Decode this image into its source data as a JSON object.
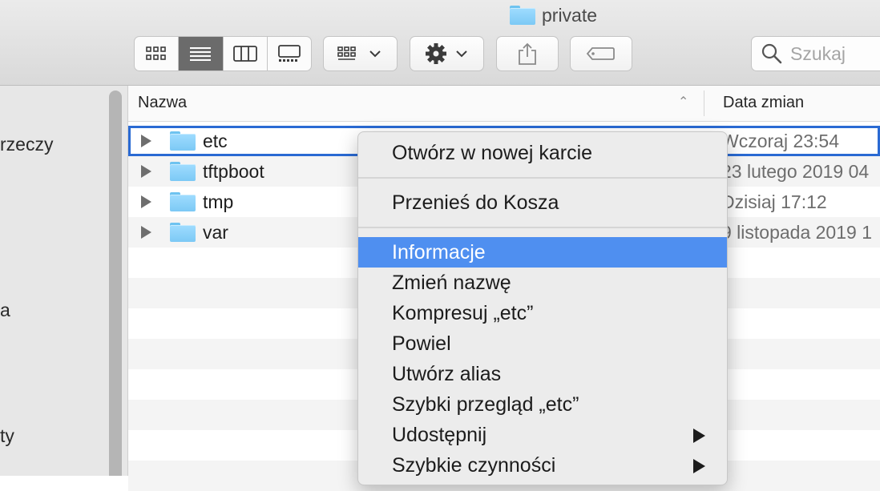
{
  "window": {
    "title": "private"
  },
  "toolbar": {
    "view_icons": [
      "icon-view-icon",
      "list-view-icon",
      "column-view-icon",
      "gallery-view-icon"
    ],
    "active_view": "list-view-icon",
    "search": {
      "placeholder": "Szukaj",
      "value": ""
    }
  },
  "sidebar": {
    "items": [
      {
        "label": "rzeczy"
      },
      {
        "label": "a"
      },
      {
        "label": "ty"
      }
    ]
  },
  "columns": {
    "name": "Nazwa",
    "date": "Data zmian"
  },
  "files": [
    {
      "name": "etc",
      "date": "Wczoraj 23:54",
      "selected": true
    },
    {
      "name": "tftpboot",
      "date": "23 lutego 2019 04"
    },
    {
      "name": "tmp",
      "date": "Dzisiaj 17:12"
    },
    {
      "name": "var",
      "date": "9 listopada 2019 1"
    }
  ],
  "context_menu": {
    "open_new_tab": "Otwórz w nowej karcie",
    "move_to_trash": "Przenieś do Kosza",
    "get_info": "Informacje",
    "rename": "Zmień nazwę",
    "compress": "Kompresuj „etc”",
    "duplicate": "Powiel",
    "make_alias": "Utwórz alias",
    "quick_look": "Szybki przegląd „etc”",
    "share": "Udostępnij",
    "quick_actions": "Szybkie czynności",
    "highlighted": "get_info"
  },
  "colors": {
    "highlight": "#4f8ff0",
    "selection_border": "#2a6ad3",
    "folder": "#7cc9f5"
  }
}
